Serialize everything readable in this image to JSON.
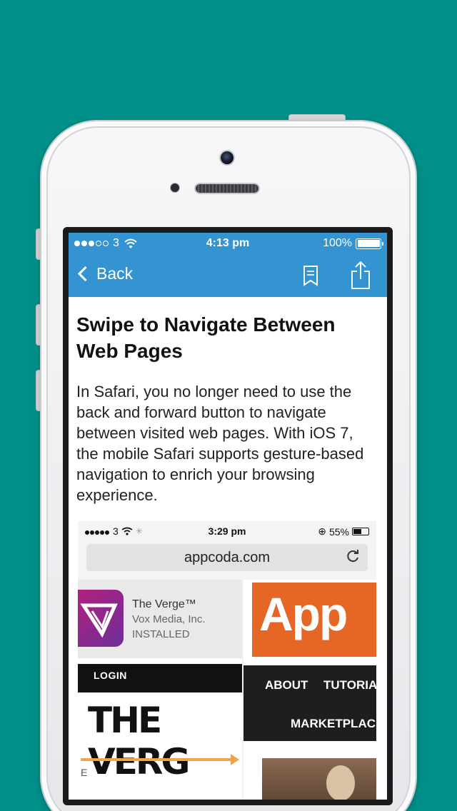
{
  "status_bar": {
    "carrier": "3",
    "time": "4:13 pm",
    "battery": "100%"
  },
  "nav": {
    "back_label": "Back"
  },
  "article": {
    "title": "Swipe to Navigate Between Web Pages",
    "body": "In Safari, you no longer need to use the back and forward button to navigate between visited web pages. With iOS 7, the mobile Safari supports gesture-based navigation to enrich your browsing experience."
  },
  "screenshot": {
    "status_carrier": "3",
    "status_time": "3:29 pm",
    "status_battery": "55%",
    "url": "appcoda.com",
    "app_name": "The Verge™",
    "app_publisher": "Vox Media, Inc.",
    "app_state": "INSTALLED",
    "login_label": "LOGIN",
    "verge_logo": "THE VERG",
    "appcoda_logo": "App",
    "menu": [
      "ABOUT",
      "TUTORIALS",
      "MARKETPLACE"
    ],
    "left_fragment": "E"
  },
  "colors": {
    "background": "#00908a",
    "nav_blue": "#3493d1",
    "accent_orange": "#e66625"
  }
}
